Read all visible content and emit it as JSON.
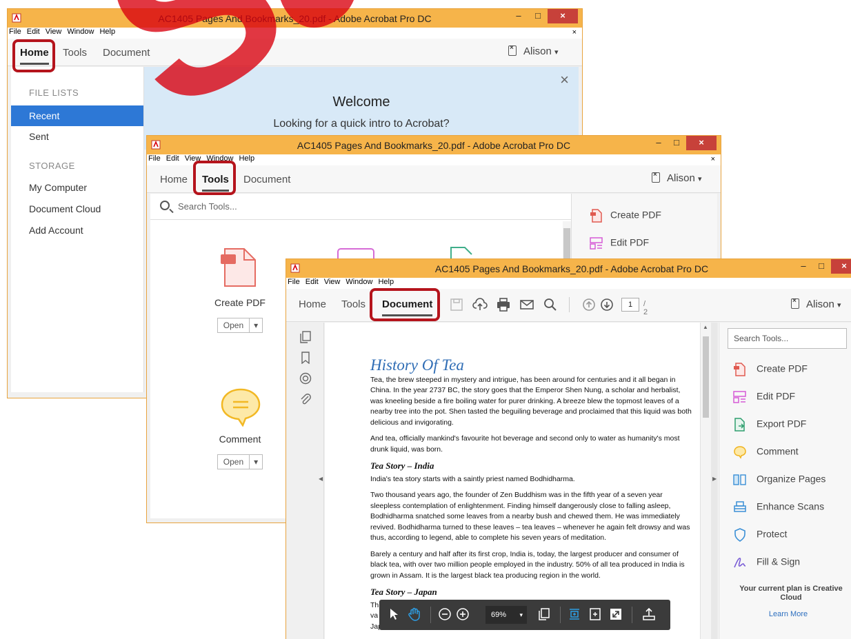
{
  "app": {
    "title": "AC1405 Pages And Bookmarks_20.pdf - Adobe Acrobat Pro DC",
    "menu": [
      "File",
      "Edit",
      "View",
      "Window",
      "Help"
    ],
    "tabs": [
      "Home",
      "Tools",
      "Document"
    ],
    "user": "Alison",
    "user_caret": "▾",
    "close_glyph": "×",
    "win_min": "–",
    "win_max": "□",
    "win_close": "×"
  },
  "watermark": "Sample",
  "home": {
    "sidebar": {
      "file_lists_label": "FILE LISTS",
      "storage_label": "STORAGE",
      "items": [
        "Recent",
        "Sent",
        "My Computer",
        "Document Cloud",
        "Add Account"
      ],
      "selected": "Recent"
    },
    "welcome": {
      "title": "Welcome",
      "subtitle": "Looking for a quick intro to Acrobat?"
    }
  },
  "tools": {
    "search_placeholder": "Search Tools...",
    "cards": [
      {
        "label": "Create PDF",
        "open": "Open",
        "icon": "create-pdf-icon"
      },
      {
        "label": "Comment",
        "open": "Open",
        "icon": "comment-icon"
      }
    ],
    "right_pane": [
      "Create PDF",
      "Edit PDF"
    ]
  },
  "document": {
    "page_number": "1",
    "page_total": "/ 2",
    "search_placeholder": "Search Tools...",
    "right_tools": [
      "Create PDF",
      "Edit PDF",
      "Export PDF",
      "Comment",
      "Organize Pages",
      "Enhance Scans",
      "Protect",
      "Fill & Sign"
    ],
    "plan_text": "Your current plan is Creative Cloud",
    "learn_more": "Learn More",
    "zoom": "69%",
    "zoom_caret": "▾",
    "content": {
      "title": "History Of Tea",
      "p1": "Tea, the brew steeped in mystery and intrigue, has been around for centuries and it all began in China. In the year 2737 BC, the story goes that the Emperor Shen Nung, a scholar and herbalist, was kneeling beside a fire boiling water for purer drinking. A breeze blew the topmost leaves of a nearby tree into the pot. Shen tasted the beguiling beverage and proclaimed that this liquid was both delicious and invigorating.",
      "p2": "And tea, officially mankind's favourite hot beverage and second only to water as humanity's most drunk liquid, was born.",
      "h2": "Tea Story – India",
      "p3": "India's tea story starts with a saintly priest named Bodhidharma.",
      "p4": "Two thousand years ago, the founder of Zen Buddhism was in the fifth year of a seven year sleepless contemplation of enlightenment. Finding himself dangerously close to falling asleep, Bodhidharma snatched some leaves from a nearby bush and chewed them. He was immediately revived. Bodhidharma turned to these leaves – tea leaves – whenever he again felt drowsy and was thus, according to legend, able to complete his seven years of meditation.",
      "p5": "Barely a century and half after its first crop, India is, today, the largest producer and consumer of black tea, with over two million people employed in the industry. 50% of all tea produced in India is grown in Assam. It is the largest black tea producing region in the world.",
      "h3": "Tea Story – Japan",
      "p6a": "Th",
      "p6b": "va",
      "p6c": "Jap"
    }
  },
  "colors": {
    "titlebar": "#f6b44a",
    "highlight": "#b5141c",
    "selected": "#2d78d6",
    "watermark": "#d9000e",
    "link": "#2d6fbf"
  }
}
